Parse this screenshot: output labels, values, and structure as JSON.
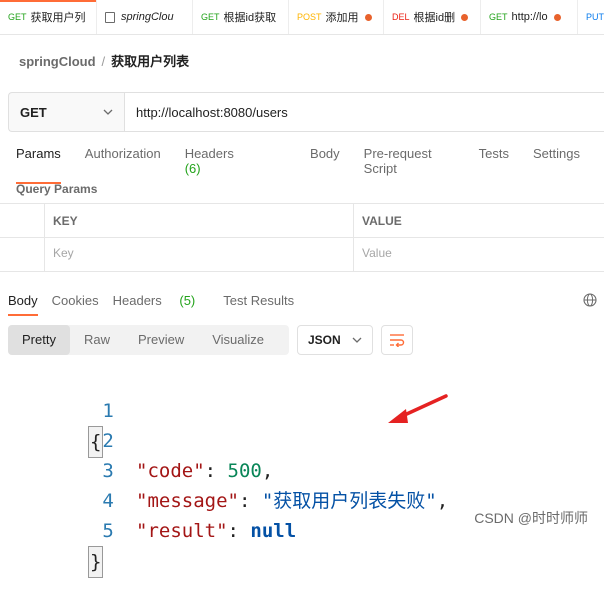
{
  "tabs": [
    {
      "method": "GET",
      "title": "获取用户列",
      "method_color": "#23a31b",
      "active": true,
      "dot": false
    },
    {
      "method": "",
      "title": "springClou",
      "method_color": "#6b6b6b",
      "active": false,
      "dot": false,
      "icon": true
    },
    {
      "method": "GET",
      "title": "根据id获取",
      "method_color": "#23a31b",
      "active": false,
      "dot": false
    },
    {
      "method": "POST",
      "title": "添加用",
      "method_color": "#ffb400",
      "active": false,
      "dot": true
    },
    {
      "method": "DEL",
      "title": "根据id删",
      "method_color": "#eb2013",
      "active": false,
      "dot": true
    },
    {
      "method": "GET",
      "title": "http://lo",
      "method_color": "#23a31b",
      "active": false,
      "dot": true
    },
    {
      "method": "PUT",
      "title": "",
      "method_color": "#097bed",
      "active": false,
      "dot": false
    }
  ],
  "breadcrumb": {
    "collection": "springCloud",
    "separator": "/",
    "request": "获取用户列表"
  },
  "request": {
    "method": "GET",
    "url": "http://localhost:8080/users"
  },
  "request_tabs": {
    "params": "Params",
    "authorization": "Authorization",
    "headers": "Headers",
    "headers_count": "(6)",
    "body": "Body",
    "prerequest": "Pre-request Script",
    "tests": "Tests",
    "settings": "Settings"
  },
  "query_params": {
    "title": "Query Params",
    "key_header": "KEY",
    "value_header": "VALUE",
    "key_placeholder": "Key",
    "value_placeholder": "Value"
  },
  "response_tabs": {
    "body": "Body",
    "cookies": "Cookies",
    "headers": "Headers",
    "headers_count": "(5)",
    "test_results": "Test Results"
  },
  "format_bar": {
    "pretty": "Pretty",
    "raw": "Raw",
    "preview": "Preview",
    "visualize": "Visualize",
    "format": "JSON"
  },
  "code": {
    "line_numbers": [
      "1",
      "2",
      "3",
      "4",
      "5"
    ],
    "open_brace": "{",
    "close_brace": "}",
    "code_key": "\"code\"",
    "code_val": "500",
    "message_key": "\"message\"",
    "message_val": "\"获取用户列表失败\"",
    "result_key": "\"result\"",
    "result_val": "null"
  },
  "watermark": "CSDN @时时师师",
  "colors": {
    "accent": "#ff6c37",
    "get": "#23a31b",
    "arrow": "#e52222"
  }
}
